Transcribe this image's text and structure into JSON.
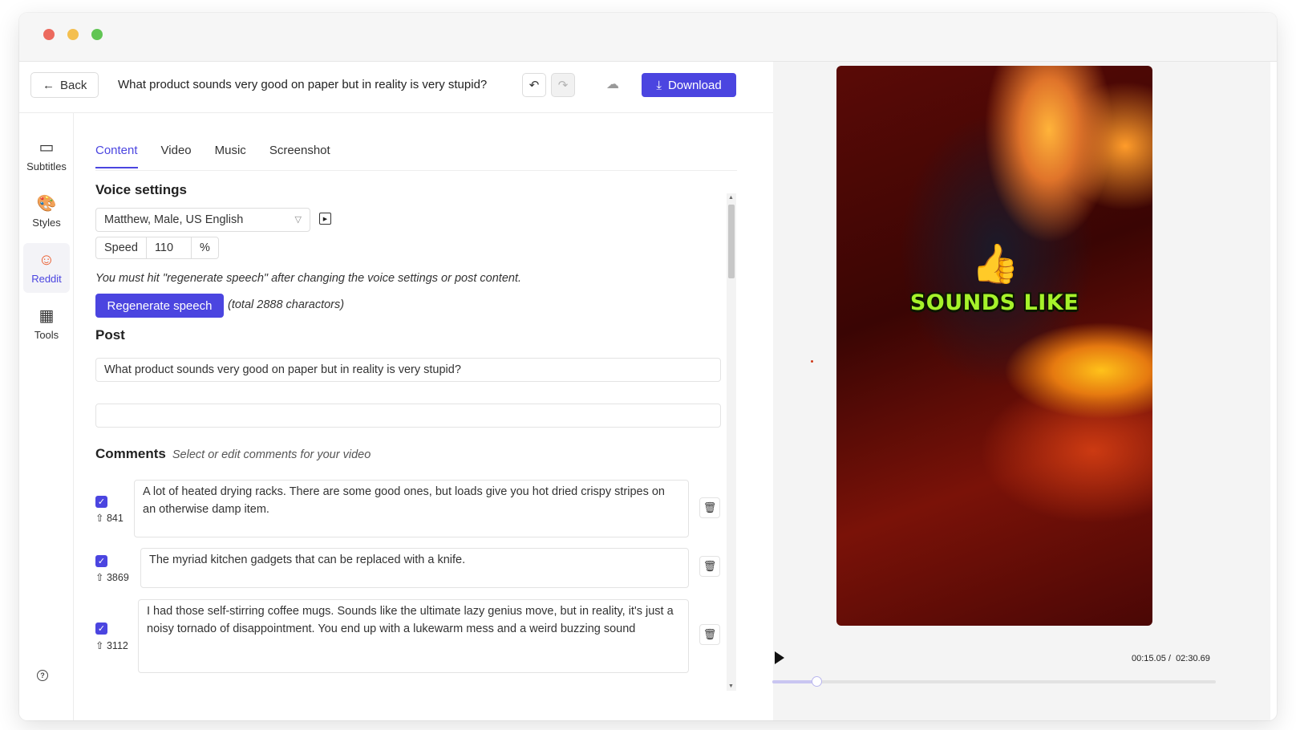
{
  "header": {
    "back_label": "Back",
    "post_title": "What product sounds very good on paper but in reality is very stupid?",
    "download_label": "Download"
  },
  "sidebar": {
    "items": [
      {
        "label": "Subtitles",
        "icon": "subtitles-icon"
      },
      {
        "label": "Styles",
        "icon": "palette-icon"
      },
      {
        "label": "Reddit",
        "icon": "reddit-icon",
        "active": true
      },
      {
        "label": "Tools",
        "icon": "grid-icon"
      }
    ]
  },
  "tabs": [
    {
      "label": "Content",
      "active": true
    },
    {
      "label": "Video"
    },
    {
      "label": "Music"
    },
    {
      "label": "Screenshot"
    }
  ],
  "voice": {
    "heading": "Voice settings",
    "selected_voice": "Matthew, Male, US English",
    "speed_label": "Speed",
    "speed_value": "110",
    "speed_unit": "%",
    "note": "You must hit \"regenerate speech\" after changing the voice settings or post content.",
    "regenerate_label": "Regenerate speech",
    "total_text": "(total 2888 charactors)"
  },
  "post": {
    "heading": "Post",
    "title_value": "What product sounds very good on paper but in reality is very stupid?",
    "body_value": ""
  },
  "comments": {
    "heading": "Comments",
    "subheading": "Select or edit comments for your video",
    "items": [
      {
        "votes": "841",
        "checked": true,
        "text": "A lot of heated drying racks. There are some good ones, but loads give you hot dried crispy stripes on an otherwise damp item."
      },
      {
        "votes": "3869",
        "checked": true,
        "text": "The myriad kitchen gadgets that can be replaced with a knife."
      },
      {
        "votes": "3112",
        "checked": true,
        "text": "I had those self-stirring coffee mugs. Sounds like the ultimate lazy genius move, but in reality, it's just a noisy tornado of disappointment. You end up with a lukewarm mess and a weird buzzing sound"
      }
    ]
  },
  "preview": {
    "caption": "SOUNDS LIKE",
    "emoji": "👍",
    "current_time": "00:15.05",
    "total_time": "02:30.69",
    "progress": 0.1
  },
  "colors": {
    "accent": "#4b45e0",
    "caption": "#a6f22a"
  }
}
